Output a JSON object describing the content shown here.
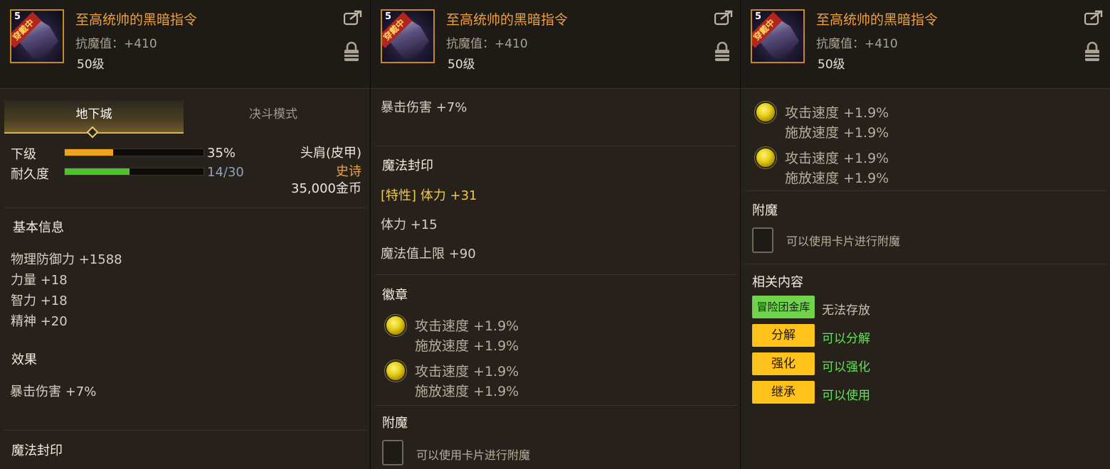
{
  "item": {
    "name": "至高统帅的黑暗指令",
    "stat": "抗魔值：+410",
    "level": "50级",
    "level_mark": "5",
    "badge": "穿戴中"
  },
  "tabs": {
    "active": "地下城",
    "inactive": "决斗模式"
  },
  "grade": {
    "label": "下级",
    "value": "35%",
    "fraction": 0.35
  },
  "durability": {
    "label": "耐久度",
    "value": "14/30",
    "fraction": 0.467
  },
  "equip_info": {
    "slot": "头肩(皮甲)",
    "rarity": "史诗",
    "price": "35,000金币"
  },
  "basic_info": {
    "title": "基本信息",
    "stats": [
      "物理防御力 +1588",
      "力量 +18",
      "智力 +18",
      "精神 +20"
    ]
  },
  "effect": {
    "title": "效果",
    "text": "暴击伤害 +7%"
  },
  "magic_seal": {
    "title": "魔法封印",
    "special": "[特性] 体力 +31",
    "lines": [
      "体力 +15",
      "魔法值上限 +90"
    ]
  },
  "emblem": {
    "title": "徽章",
    "slots": [
      {
        "line1": "攻击速度 +1.9%",
        "line2": "施放速度 +1.9%"
      },
      {
        "line1": "攻击速度 +1.9%",
        "line2": "施放速度 +1.9%"
      }
    ]
  },
  "enchant": {
    "title": "附魔",
    "hint": "可以使用卡片进行附魔"
  },
  "related": {
    "title": "相关内容",
    "rows": [
      {
        "button": "冒险团金库",
        "status": "无法存放"
      },
      {
        "button": "分解",
        "status": "可以分解"
      },
      {
        "button": "强化",
        "status": "可以强化"
      },
      {
        "button": "继承",
        "status": "可以使用"
      }
    ]
  },
  "colors": {
    "item_name": "#f0a03c",
    "rarity": "#f0a03c",
    "grade_bar": "#f0a21c",
    "durability_bar": "#4ec22a",
    "durability_value": "#8fa0b8",
    "related_green": "#6fd34b",
    "related_yellow": "#ffc21a"
  }
}
